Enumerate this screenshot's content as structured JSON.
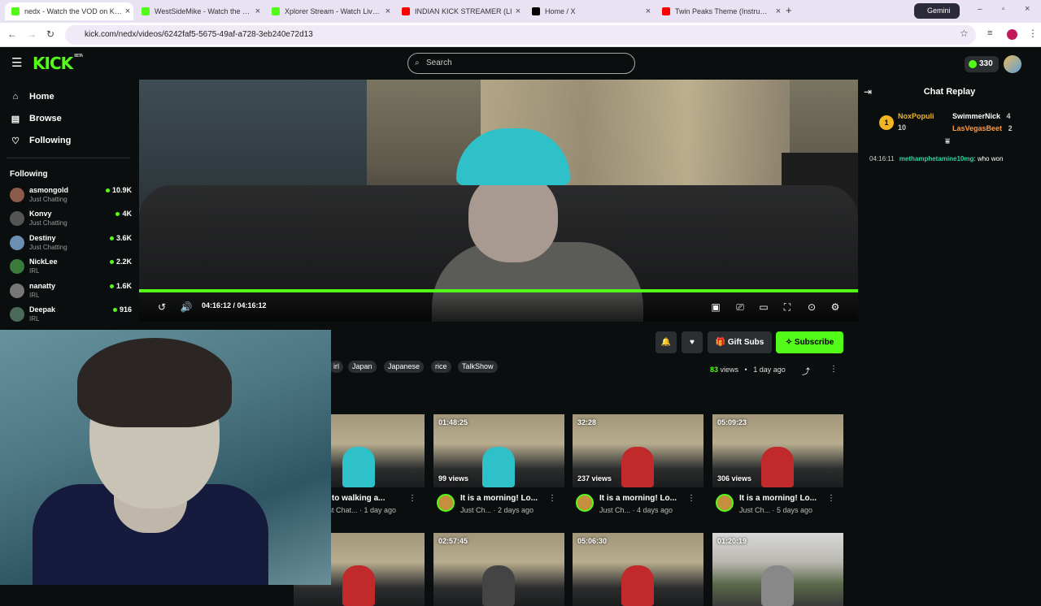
{
  "browser": {
    "tabs": [
      {
        "title": "nedx - Watch the VOD on Kick",
        "color": "#53fc18",
        "active": true
      },
      {
        "title": "WestSideMike - Watch the VOD",
        "color": "#53fc18"
      },
      {
        "title": "Xplorer Stream - Watch Live on",
        "color": "#53fc18"
      },
      {
        "title": "INDIAN KICK STREAMER (LI",
        "color": "#ff0000"
      },
      {
        "title": "Home / X",
        "color": "#000000"
      },
      {
        "title": "Twin Peaks Theme (Instrumenta",
        "color": "#ff0000"
      }
    ],
    "gemini_label": "Gemini",
    "url": "kick.com/nedx/videos/6242faf5-5675-49af-a728-3eb240e72d13"
  },
  "header": {
    "logo": "KICK",
    "logo_badge": "BETA",
    "search_placeholder": "Search",
    "points": "330"
  },
  "sidebar": {
    "nav": [
      {
        "label": "Home",
        "icon": "home-icon"
      },
      {
        "label": "Browse",
        "icon": "browse-icon"
      },
      {
        "label": "Following",
        "icon": "heart-icon"
      }
    ],
    "following_title": "Following",
    "channels": [
      {
        "name": "asmongold",
        "category": "Just Chatting",
        "viewers": "10.9K",
        "color": "#8a5a4a"
      },
      {
        "name": "Konvy",
        "category": "Just Chatting",
        "viewers": "4K",
        "color": "#555"
      },
      {
        "name": "Destiny",
        "category": "Just Chatting",
        "viewers": "3.6K",
        "color": "#6a8fb0"
      },
      {
        "name": "NickLee",
        "category": "IRL",
        "viewers": "2.2K",
        "color": "#3a7a3a"
      },
      {
        "name": "nanatty",
        "category": "IRL",
        "viewers": "1.6K",
        "color": "#777"
      },
      {
        "name": "Deepak",
        "category": "IRL",
        "viewers": "916",
        "color": "#4a6a5a"
      }
    ]
  },
  "player": {
    "time": "04:16:12 / 04:16:12",
    "progress": 1.0
  },
  "chat": {
    "title": "Chat Replay",
    "top_gifter": {
      "rank": "1",
      "name": "NoxPopuli",
      "count": "10"
    },
    "gifters": [
      {
        "name": "SwimmerNick",
        "count": "4",
        "color": "#ffffff"
      },
      {
        "name": "LasVegasBeet",
        "count": "2",
        "color": "#ff9a3c"
      }
    ],
    "message": {
      "time": "04:16:11",
      "user": "methamphetamine10mg",
      "text": ": who won"
    }
  },
  "actions": {
    "gift_subs": "Gift Subs",
    "subscribe": "Subscribe"
  },
  "tags": [
    "irl",
    "Japan",
    "Japanese",
    "rice",
    "TalkShow"
  ],
  "meta": {
    "views_count": "83",
    "views_label": " views",
    "sep": "•",
    "age": "1 day ago"
  },
  "videos": [
    {
      "duration": "",
      "views": "",
      "title": "ck to walking a...",
      "channel": "Just Chat...",
      "age": "1 day ago",
      "fig": "#2ec1c9"
    },
    {
      "duration": "01:48:25",
      "views": "99 views",
      "title": "It is a morning! Lo...",
      "channel": "Just Ch...",
      "age": "2 days ago",
      "fig": "#2ec1c9"
    },
    {
      "duration": "32:28",
      "views": "237 views",
      "title": "It is a morning! Lo...",
      "channel": "Just Ch...",
      "age": "4 days ago",
      "fig": "#c02a2a"
    },
    {
      "duration": "05:09:23",
      "views": "306 views",
      "title": "It is a morning! Lo...",
      "channel": "Just Ch...",
      "age": "5 days ago",
      "fig": "#c02a2a"
    },
    {
      "duration": "",
      "views": "",
      "title": "",
      "channel": "",
      "age": "",
      "fig": "#c02a2a"
    },
    {
      "duration": "02:57:45",
      "views": "",
      "title": "",
      "channel": "",
      "age": "",
      "fig": "#444"
    },
    {
      "duration": "05:06:30",
      "views": "",
      "title": "",
      "channel": "",
      "age": "",
      "fig": "#c02a2a"
    },
    {
      "duration": "01:20:19",
      "views": "",
      "title": "",
      "channel": "",
      "age": "",
      "fig": "#888"
    }
  ]
}
